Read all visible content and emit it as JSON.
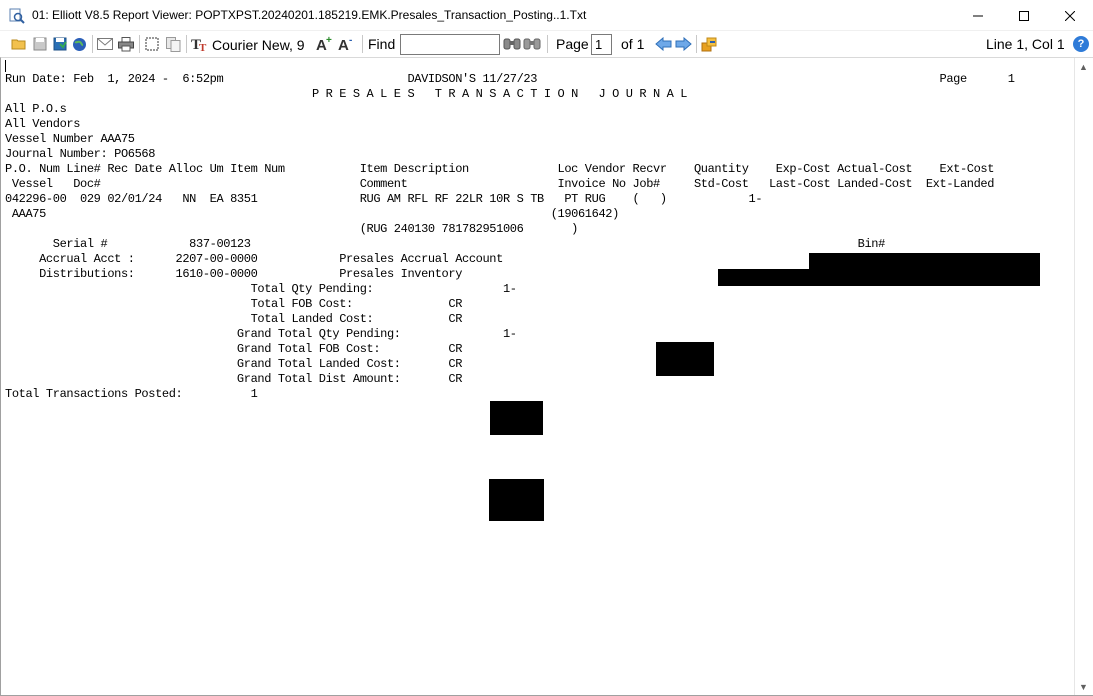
{
  "window": {
    "title": "01: Elliott V8.5 Report Viewer: POPTXPST.20240201.185219.EMK.Presales_Transaction_Posting..1.Txt",
    "minimize_icon": "minimize-icon",
    "maximize_icon": "maximize-icon",
    "close_icon": "close-icon"
  },
  "toolbar": {
    "icons": [
      "open-folder-icon",
      "save-icon",
      "save-green-icon",
      "globe-icon",
      "email-icon",
      "print-icon",
      "select-icon",
      "copy-icon",
      "font-icon",
      "font-increase-icon",
      "font-decrease-icon",
      "binoculars-icon",
      "binoculars-prev-icon",
      "arrow-left-icon",
      "arrow-right-icon",
      "export-icon",
      "help-icon"
    ],
    "font": "Courier New, 9",
    "find_label": "Find",
    "find_value": "",
    "page_label": "Page",
    "page_value": "1",
    "of_label": "of 1",
    "position": "Line 1, Col 1",
    "help_glyph": "?"
  },
  "report": {
    "line1": "Run Date: Feb  1, 2024 -  6:52pm                           DAVIDSON'S 11/27/23                                                           Page      1",
    "line2": "",
    "line3": "                                             P R E S A L E S   T R A N S A C T I O N   J O U R N A L",
    "line4": "",
    "line5": "All P.O.s",
    "line6": "All Vendors",
    "line7": "Vessel Number AAA75",
    "line8": "Journal Number: PO6568",
    "line9": "",
    "line10": "P.O. Num Line# Rec Date Alloc Um Item Num           Item Description             Loc Vendor Recvr    Quantity    Exp-Cost Actual-Cost    Ext-Cost",
    "line11": " Vessel   Doc#                                      Comment                      Invoice No Job#     Std-Cost   Last-Cost Landed-Cost  Ext-Landed",
    "line12": "",
    "line13": "042296-00  029 02/01/24   NN  EA 8351               RUG AM RFL RF 22LR 10R S TB   PT RUG    (   )            1-",
    "line14": " AAA75                                                                          (19061642)",
    "line15": "                                                    (RUG 240130 781782951006       )",
    "line16": "",
    "line17": "       Serial #            837-00123                                                                                         Bin#",
    "line18": "",
    "line19": "     Accrual Acct :      2207-00-0000            Presales Accrual Account                                       ",
    "line20": "     Distributions:      1610-00-0000            Presales Inventory                                              CR",
    "line21": "",
    "line22": "                                    Total Qty Pending:                   1-",
    "line23": "                                    Total FOB Cost:              CR",
    "line24": "                                    Total Landed Cost:           CR",
    "line25": "",
    "line26": "",
    "line27": "                                  Grand Total Qty Pending:               1-",
    "line28": "                                  Grand Total FOB Cost:          CR",
    "line29": "                                  Grand Total Landed Cost:       CR",
    "line30": "                                  Grand Total Dist Amount:       CR",
    "line31": "Total Transactions Posted:          1"
  }
}
